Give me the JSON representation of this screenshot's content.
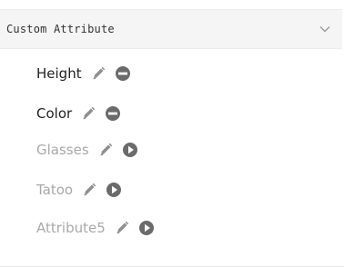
{
  "panel": {
    "title": "Custom Attribute",
    "expand_icon": "chevron-down-icon"
  },
  "colors": {
    "active_text": "#222222",
    "inactive_text": "#a9a9a9",
    "active_icon": "#8f8f8f",
    "inactive_icon": "#6f6f6f",
    "header_bg": "#f5f5f5"
  },
  "attributes": [
    {
      "label": "Height",
      "state": "active",
      "edit_icon": "pencil-icon",
      "toggle_icon": "minus-circle-icon"
    },
    {
      "label": "Color",
      "state": "active",
      "edit_icon": "pencil-icon",
      "toggle_icon": "minus-circle-icon"
    },
    {
      "label": "Glasses",
      "state": "inactive",
      "edit_icon": "pencil-icon",
      "toggle_icon": "play-circle-icon"
    },
    {
      "label": "Tatoo",
      "state": "inactive",
      "edit_icon": "pencil-icon",
      "toggle_icon": "play-circle-icon"
    },
    {
      "label": "Attribute5",
      "state": "inactive",
      "edit_icon": "pencil-icon",
      "toggle_icon": "play-circle-icon"
    }
  ]
}
